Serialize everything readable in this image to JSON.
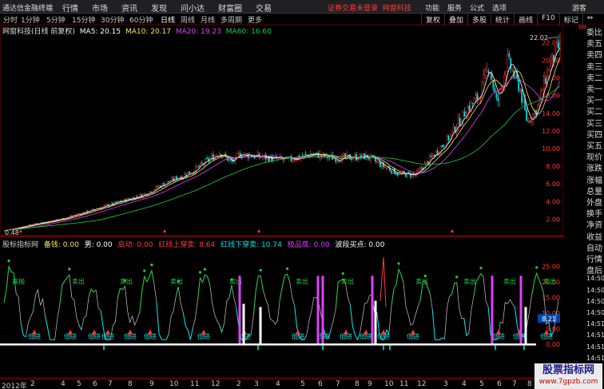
{
  "topbar": {
    "brand": "通达信金融终端",
    "menu": [
      "行情",
      "市场",
      "资讯",
      "发现",
      "问小达",
      "财富圈",
      "交易"
    ],
    "notice": "证券交易未登录",
    "notice2": "网窗科技",
    "right_menu": [
      "功能",
      "服务",
      "公式",
      "选项"
    ],
    "guest": "游客",
    "window_controls": "▢ ▁ ✕"
  },
  "periods": [
    "分时",
    "1分钟",
    "5分钟",
    "15分钟",
    "30分钟",
    "60分钟",
    "日线",
    "周线",
    "月线",
    "多周期",
    "更多"
  ],
  "active_period": "日线",
  "toolbar": [
    "复权",
    "叠加",
    "多股",
    "统计",
    "画线",
    "F10",
    "标记",
    "⇔"
  ],
  "main_title": {
    "stock": "网窗科技(日线 前复权)",
    "ma5": "MA5: 20.15",
    "ma10": "MA10: 20.17",
    "ma20": "MA20: 19.23",
    "ma60": "MA60: 16.60"
  },
  "price_axis": [
    "22.00",
    "20.00",
    "18.00",
    "16.00",
    "14.00",
    "12.00",
    "10.00",
    "8.00",
    "6.00",
    "4.00",
    "2.00"
  ],
  "price_range": [
    0.5,
    23.3
  ],
  "high_label": "22.02",
  "low_label": "0.48",
  "indicator_title": {
    "name": "股标指标网",
    "v1": "备钱: 0.00",
    "v2": "男: 0.00",
    "v3": "启动: 0.00",
    "v4": "红线上穿卖: 8.64",
    "v5": "红线下穿卖: 10.74",
    "v6": "极品底: 0.00",
    "v7": "波段买点: 0.00"
  },
  "indicator_axis": [
    "25.00",
    "20.00",
    "15.00",
    "10.00",
    "5.00",
    "0.00"
  ],
  "indicator_range": [
    -2,
    30
  ],
  "indicator_current": "8.21",
  "right_panel": [
    "委比",
    "卖五",
    "卖四",
    "卖三",
    "卖二",
    "卖一",
    "买一",
    "买二",
    "买三",
    "买四",
    "买五",
    "现价",
    "涨跌",
    "涨幅",
    "总量",
    "外盘",
    "换手",
    "净资",
    "收益",
    "自动",
    "行情",
    "盘后",
    "14:50",
    "14:50",
    "14:50",
    "14:50",
    "14:51",
    "14:51",
    "14:51",
    "14:51"
  ],
  "right_top_label": "SH",
  "time_axis": {
    "year": "2012年",
    "months": [
      "2",
      "4",
      "5",
      "6",
      "7",
      "8",
      "9",
      "10",
      "11",
      "12",
      "2",
      "3",
      "4",
      "5",
      "6",
      "7",
      "8",
      "9",
      "10",
      "11",
      "12",
      "3",
      "4",
      "5",
      "6",
      "7",
      "8",
      "9"
    ]
  },
  "signals": {
    "low": "低进",
    "sell": "卖出",
    "high": "高抛"
  },
  "colors": {
    "bg": "#000000",
    "up": "#ff3a3a",
    "down": "#00e0e0",
    "ma5": "#ffffff",
    "ma10": "#f7e45c",
    "ma20": "#e040fb",
    "ma60": "#22cc44"
  },
  "watermark": {
    "line1": "股票指标网",
    "line2": "www.7gpzb.com"
  }
}
